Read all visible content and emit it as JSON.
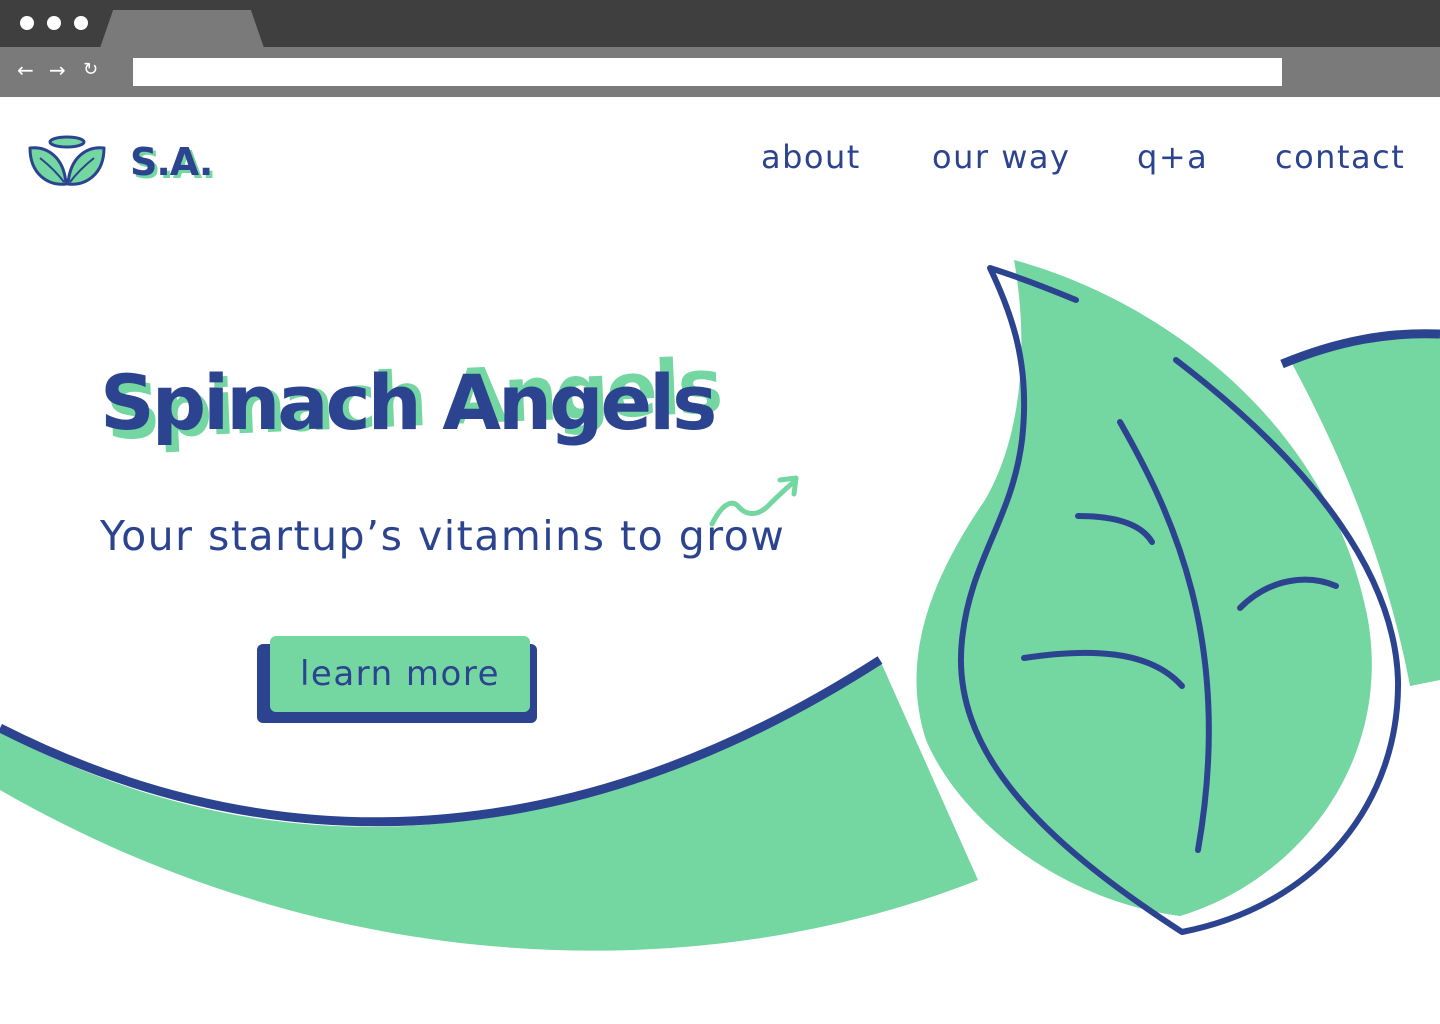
{
  "browser": {
    "url": "",
    "back_icon": "←",
    "forward_icon": "→",
    "reload_icon": "↻"
  },
  "brand": {
    "name": "S.A."
  },
  "nav": {
    "items": [
      {
        "label": "about"
      },
      {
        "label": "our way"
      },
      {
        "label": "q+a"
      },
      {
        "label": "contact"
      }
    ]
  },
  "hero": {
    "title": "Spinach Angels",
    "subtitle": "Your startup’s vitamins to grow",
    "cta_label": "learn more"
  },
  "colors": {
    "primary": "#2c4490",
    "accent": "#74d6a0",
    "background": "#ffffff",
    "chrome_dark": "#3f3f3f",
    "chrome_light": "#7a7a7a"
  }
}
